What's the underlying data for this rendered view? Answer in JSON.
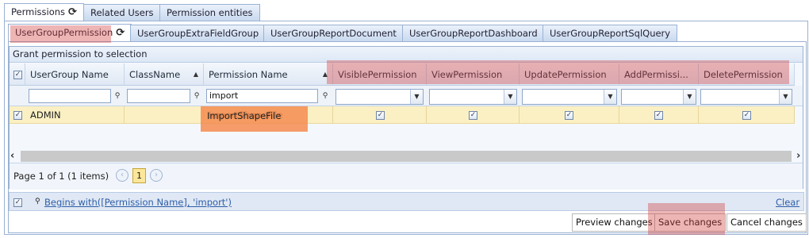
{
  "outer_tabs": [
    {
      "label": "Permissions",
      "active": true
    },
    {
      "label": "Related Users",
      "active": false
    },
    {
      "label": "Permission entities",
      "active": false
    }
  ],
  "inner_tabs": [
    {
      "label": "UserGroupPermission",
      "active": true
    },
    {
      "label": "UserGroupExtraFieldGroup",
      "active": false
    },
    {
      "label": "UserGroupReportDocument",
      "active": false
    },
    {
      "label": "UserGroupReportDashboard",
      "active": false
    },
    {
      "label": "UserGroupReportSqlQuery",
      "active": false
    }
  ],
  "grid": {
    "title": "Grant permission to selection",
    "columns": [
      "UserGroup Name",
      "ClassName",
      "Permission Name",
      "VisiblePermission",
      "ViewPermission",
      "UpdatePermission",
      "AddPermissi...",
      "DeletePermission"
    ],
    "filter_values": {
      "usergroup": "",
      "classname": "",
      "permission": "import"
    },
    "rows": [
      {
        "selected": true,
        "usergroup": "ADMIN",
        "classname": "",
        "permission": "ImportShapeFile",
        "visible": true,
        "view": true,
        "update": true,
        "add": true,
        "delete": true
      }
    ]
  },
  "pager": {
    "summary": "Page 1 of 1 (1 items)",
    "current_page": "1"
  },
  "filter_expression": {
    "text": "Begins with([Permission Name], 'import')",
    "clear_label": "Clear"
  },
  "actions": {
    "preview": "Preview changes",
    "save": "Save changes",
    "cancel": "Cancel changes"
  },
  "colors": {
    "highlight": "#d23c3c",
    "row_selected": "#fbf0c3",
    "border": "#9ab1d3"
  }
}
